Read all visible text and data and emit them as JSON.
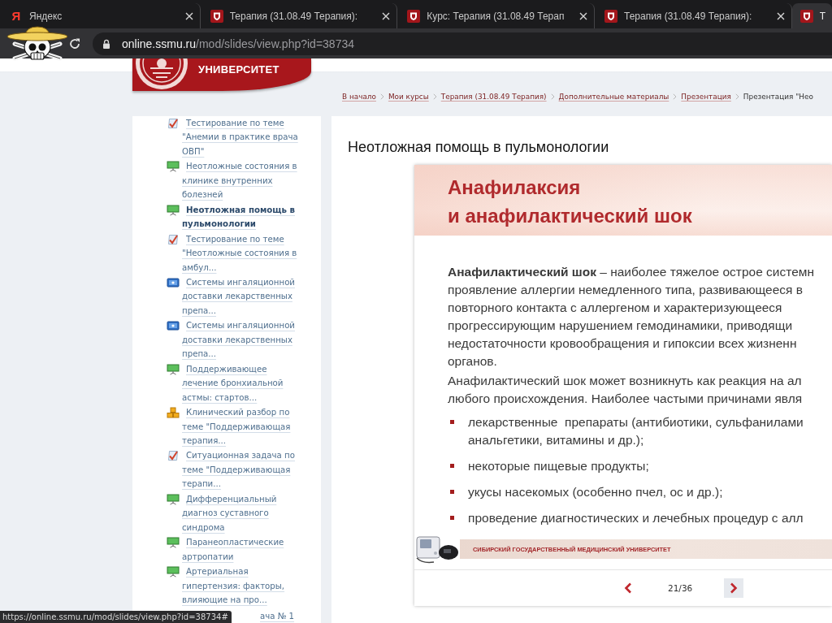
{
  "browser": {
    "tabs": [
      {
        "kind": "letter",
        "favicon_text": "Я",
        "label": "Яндекс",
        "selected": false
      },
      {
        "kind": "crest",
        "label": "Терапия (31.08.49 Терапия):",
        "selected": false
      },
      {
        "kind": "crest",
        "label": "Курс: Терапия (31.08.49 Терап",
        "selected": false
      },
      {
        "kind": "crest",
        "label": "Терапия (31.08.49 Терапия):",
        "selected": false
      },
      {
        "kind": "crest",
        "label": "Т",
        "selected": true
      }
    ],
    "address": {
      "host": "online.ssmu.ru",
      "path": "/mod/slides/view.php?id=38734"
    }
  },
  "header": {
    "logo_text": "УНИВЕРСИТЕТ"
  },
  "breadcrumb": [
    {
      "label": "В начало",
      "link": true
    },
    {
      "label": "Мои курсы",
      "link": true
    },
    {
      "label": "Терапия (31.08.49 Терапия)",
      "link": true
    },
    {
      "label": "Дополнительные материалы",
      "link": true
    },
    {
      "label": "Презентация",
      "link": true
    },
    {
      "label": "Презентация \"Нео",
      "link": false
    }
  ],
  "sidebar": {
    "items": [
      {
        "kind": "quiz",
        "label": "Тестирование по теме \"Анемии в практике врача ОВП\"",
        "selected": false,
        "covered": false
      },
      {
        "kind": "slides",
        "label": "Неотложные состояния в клинике внутренних болезней",
        "selected": false,
        "covered": false
      },
      {
        "kind": "slides",
        "label": "Неотложная помощь в пульмонологии",
        "selected": true,
        "covered": false
      },
      {
        "kind": "quiz",
        "label": "Тестирование по теме \"Неотложные состояния в амбул...",
        "selected": false,
        "covered": false
      },
      {
        "kind": "video",
        "label": "Системы ингаляционной доставки лекарственных препа...",
        "selected": false,
        "covered": false
      },
      {
        "kind": "video",
        "label": "Системы ингаляционной доставки лекарственных препа...",
        "selected": false,
        "covered": false
      },
      {
        "kind": "slides",
        "label": "Поддерживающее лечение бронхиальной астмы: стартов...",
        "selected": false,
        "covered": false
      },
      {
        "kind": "case",
        "label": "Клинический разбор по теме \"Поддерживающая терапия...",
        "selected": false,
        "covered": false
      },
      {
        "kind": "quiz",
        "label": "Ситуационная задача по теме \"Поддерживающая терапи...",
        "selected": false,
        "covered": false
      },
      {
        "kind": "slides",
        "label": "Дифференциальный диагноз суставного синдрома",
        "selected": false,
        "covered": false
      },
      {
        "kind": "slides",
        "label": "Паранеопластические артропатии",
        "selected": false,
        "covered": false
      },
      {
        "kind": "slides",
        "label": "Артериальная гипертензия: факторы, влияющие на про...",
        "selected": false,
        "covered": false
      },
      {
        "label": "ача № 1",
        "selected": false,
        "covered": true
      }
    ]
  },
  "main": {
    "title": "Неотложная помощь в пульмонологии",
    "slide": {
      "title_lines": [
        "Анафилаксия",
        "и анафилактический шок"
      ],
      "paragraphs": [
        {
          "lines": [
            "**Анафилактический шок** – наиболее тяжелое острое системн",
            "проявление аллергии немедленного типа, развивающееся в",
            "повторного контакта с аллергеном и характеризующееся",
            "прогрессирующим нарушением гемодинамики, приводящи",
            "недостаточности кровообращения и гипоксии всех жизненн",
            "органов."
          ]
        },
        {
          "lines": [
            "Анафилактический шок может возникнуть как реакция на ал",
            "любого происхождения. Наиболее частыми причинами явля"
          ]
        }
      ],
      "bullets": [
        {
          "lines": [
            "лекарственные  препараты (антибиотики, сульфанилами",
            "анальгетики, витамины и др.);"
          ]
        },
        {
          "lines": [
            "некоторые пищевые продукты;"
          ]
        },
        {
          "lines": [
            "укусы насекомых (особенно пчел, ос и др.);"
          ]
        },
        {
          "lines": [
            "проведение диагностических и лечебных процедур с алл"
          ]
        }
      ],
      "footer_text": "СИБИРСКИЙ ГОСУДАРСТВЕННЫЙ МЕДИЦИНСКИЙ УНИВЕРСИТЕТ"
    },
    "pager": {
      "prev": {
        "highlighted": false
      },
      "counter": "21/36",
      "next": {
        "highlighted": true
      }
    }
  },
  "status_bar": {
    "url": "https://online.ssmu.ru/mod/slides/view.php?id=38734#"
  }
}
